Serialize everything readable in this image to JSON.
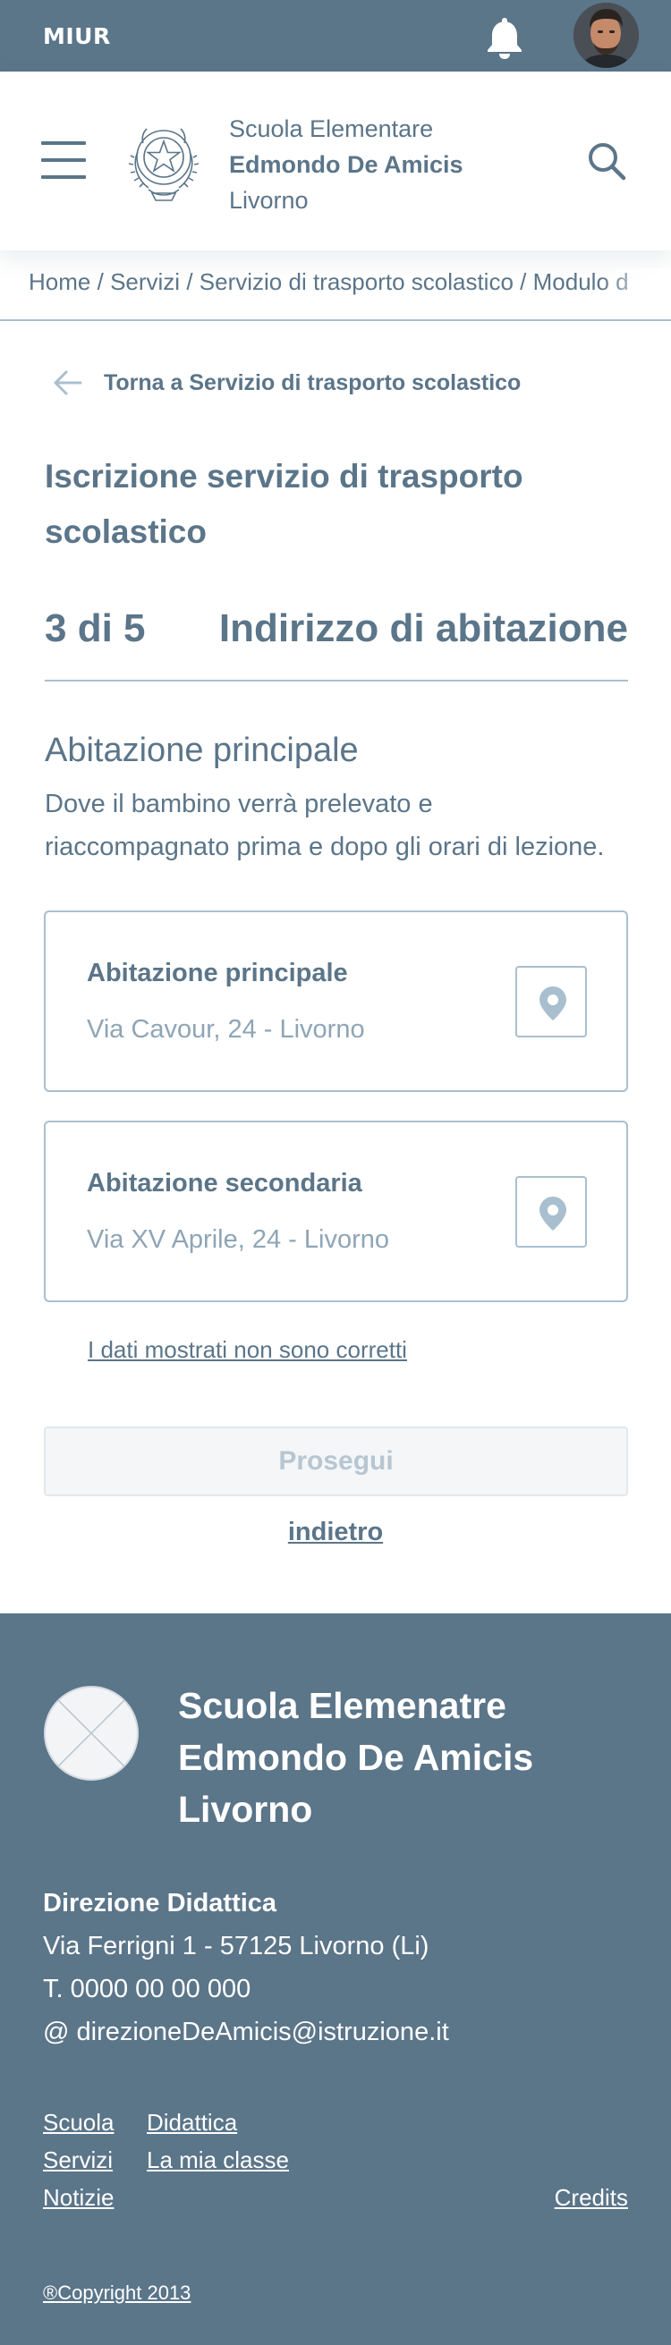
{
  "topbar": {
    "brand": "MIUR",
    "bell_icon": "bell-icon",
    "avatar_icon": "user-avatar"
  },
  "header": {
    "menu_icon": "hamburger-menu-icon",
    "emblem_icon": "italian-republic-emblem-icon",
    "school_line1": "Scuola Elementare",
    "school_line2": "Edmondo De Amicis",
    "school_line3": "Livorno",
    "search_icon": "search-icon"
  },
  "breadcrumb": {
    "items": [
      "Home",
      "Servizi",
      "Servizio di trasporto scolastico",
      "Modulo d"
    ],
    "separator": "/"
  },
  "back_link": {
    "icon": "arrow-left-icon",
    "label": "Torna a Servizio di trasporto scolastico"
  },
  "form": {
    "title_line1": "Iscrizione servizio di trasporto",
    "title_line2": "scolastico",
    "step_count": "3 di 5",
    "step_title": "Indirizzo di abitazione",
    "section_title": "Abitazione principale",
    "section_desc_line1": "Dove il bambino verrà prelevato e",
    "section_desc_line2": "riaccompagnato prima e dopo gli orari di lezione.",
    "addresses": [
      {
        "label": "Abitazione principale",
        "value": "Via Cavour, 24 - Livorno",
        "icon": "map-pin-icon"
      },
      {
        "label": "Abitazione secondaria",
        "value": "Via XV Aprile, 24 - Livorno",
        "icon": "map-pin-icon"
      }
    ],
    "wrong_data_link": "I dati mostrati non sono corretti",
    "next_button": "Prosegui",
    "back_button": "indietro"
  },
  "footer": {
    "logo_icon": "placeholder-logo-icon",
    "school_line1": "Scuola Elemenatre",
    "school_line2": "Edmondo De Amicis",
    "school_line3": "Livorno",
    "office_name": "Direzione Didattica",
    "address": "Via Ferrigni 1 - 57125 Livorno (Li)",
    "phone": "T. 0000 00 00 000",
    "email": "@ direzioneDeAmicis@istruzione.it",
    "links": [
      "Scuola",
      "Didattica",
      "Servizi",
      "La mia classe",
      "Notizie",
      "Credits"
    ],
    "copyright": "®Copyright 2013"
  },
  "colors": {
    "primary": "#5b7589",
    "border": "#a9bfcf",
    "muted_text": "#8ea5b6",
    "disabled_bg": "#f4f6f8",
    "disabled_text": "#b7c6d1"
  }
}
